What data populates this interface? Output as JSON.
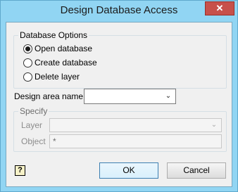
{
  "window": {
    "title": "Design Database Access",
    "close_glyph": "✕"
  },
  "database_options": {
    "legend": "Database Options",
    "options": [
      {
        "label": "Open database",
        "selected": true
      },
      {
        "label": "Create database",
        "selected": false
      },
      {
        "label": "Delete layer",
        "selected": false
      }
    ]
  },
  "design_area": {
    "label": "Design area name",
    "value": "",
    "arrow": "⌄"
  },
  "specify": {
    "legend": "Specify",
    "layer": {
      "label": "Layer",
      "value": "",
      "arrow": "⌄"
    },
    "object": {
      "label": "Object",
      "value": "*"
    }
  },
  "buttons": {
    "help_glyph": "?",
    "ok": "OK",
    "cancel": "Cancel"
  }
}
